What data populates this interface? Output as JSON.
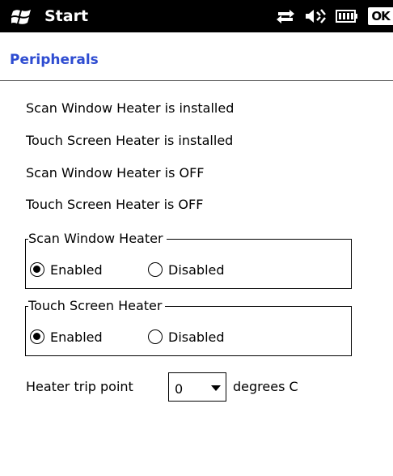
{
  "titlebar": {
    "start_label": "Start",
    "ok_label": "OK",
    "icons": [
      "windows-flag-icon",
      "connectivity-icon",
      "volume-icon",
      "battery-icon"
    ]
  },
  "header": {
    "title": "Peripherals"
  },
  "status_lines": [
    "Scan Window Heater is installed",
    "Touch Screen Heater is installed",
    "Scan Window Heater is OFF",
    "Touch Screen Heater is OFF"
  ],
  "groups": [
    {
      "legend": "Scan Window Heater",
      "options": [
        "Enabled",
        "Disabled"
      ],
      "selected": "Enabled"
    },
    {
      "legend": "Touch Screen Heater",
      "options": [
        "Enabled",
        "Disabled"
      ],
      "selected": "Enabled"
    }
  ],
  "trip_point": {
    "label": "Heater trip point",
    "value": "0",
    "units": "degrees C"
  },
  "colors": {
    "accent": "#2e4cd1",
    "titlebar": "#000000",
    "background": "#ffffff"
  }
}
